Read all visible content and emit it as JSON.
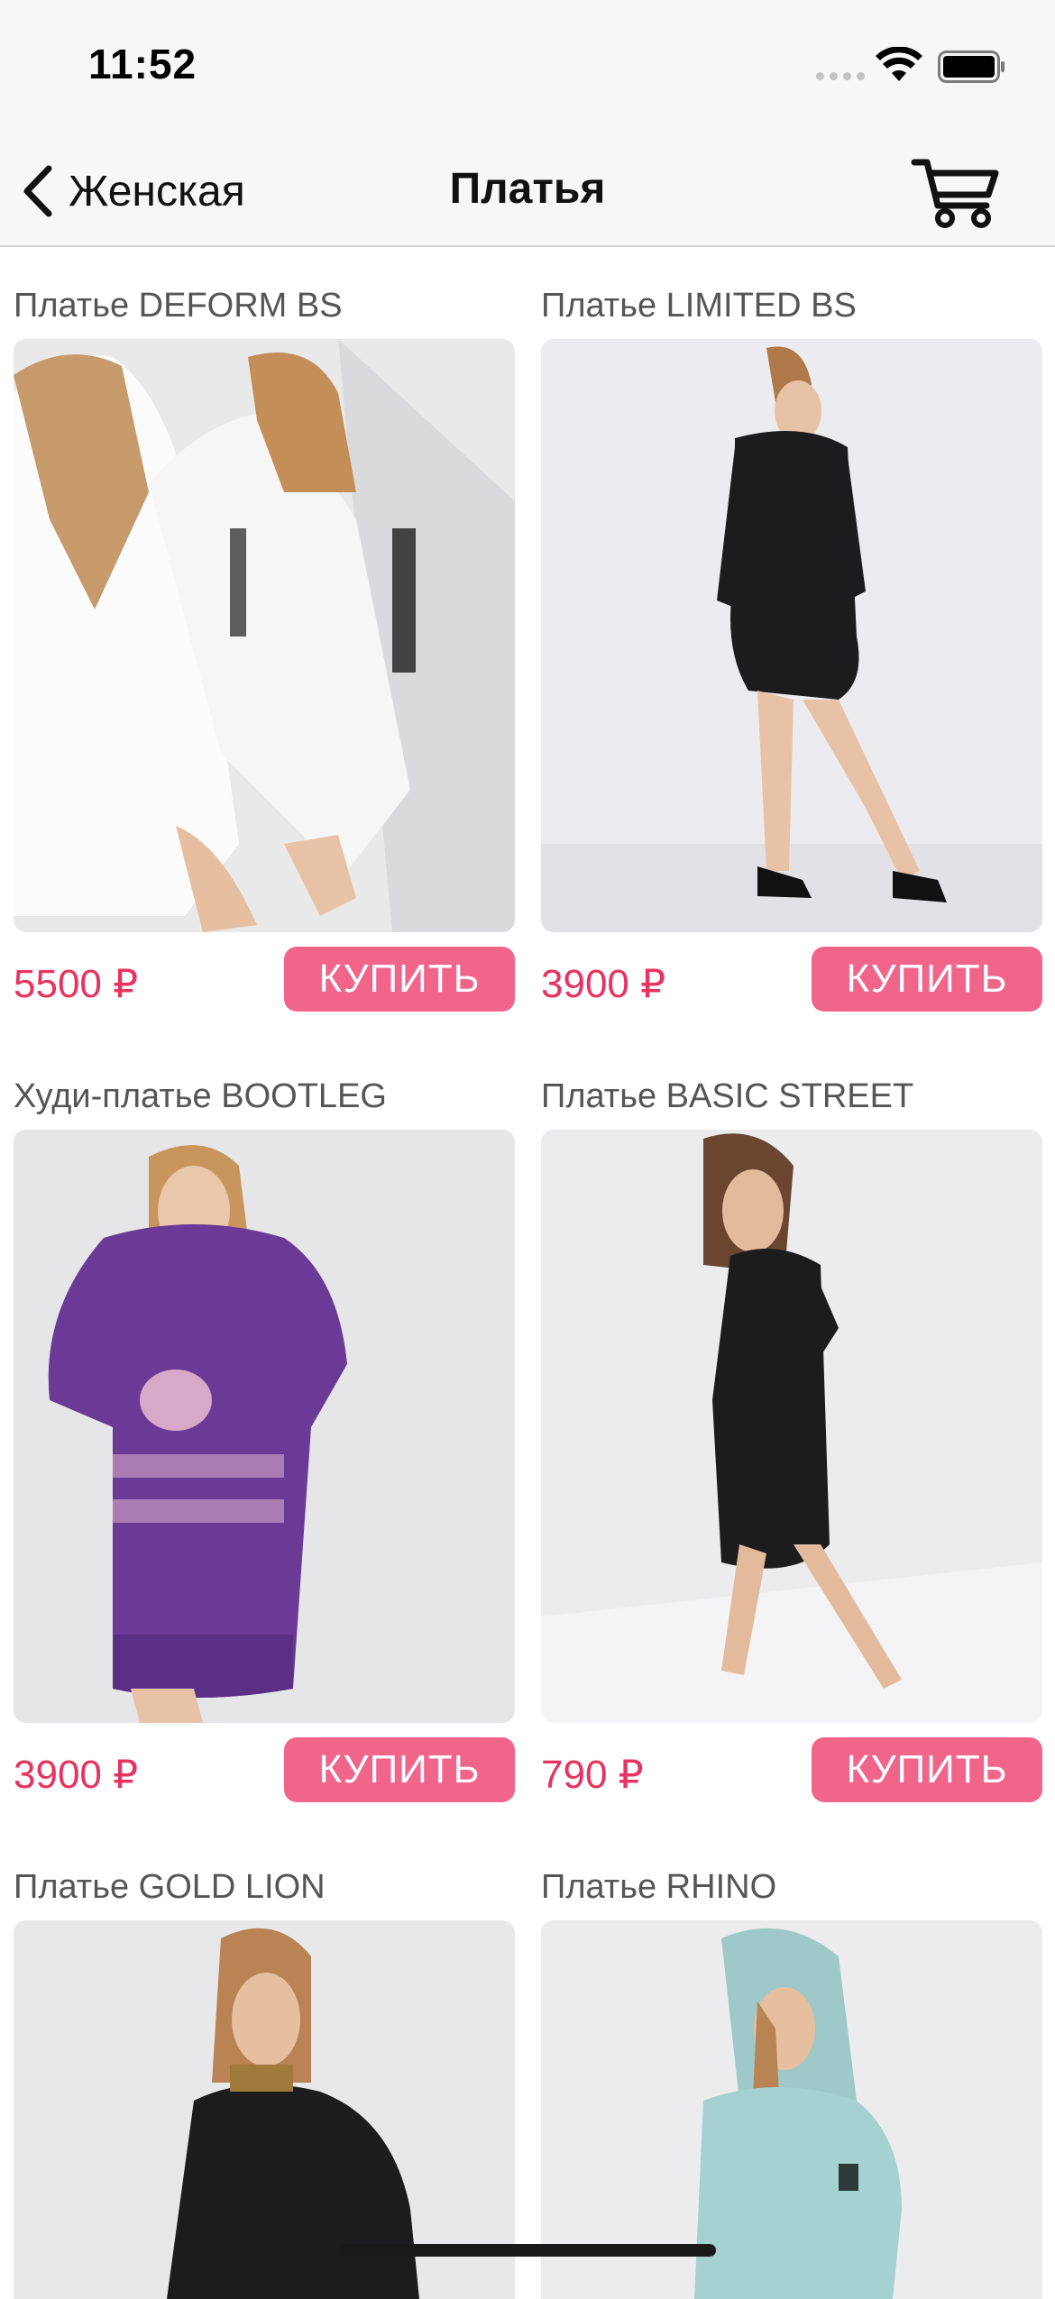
{
  "status_bar": {
    "time": "11:52"
  },
  "nav": {
    "back_label": "Женская",
    "title": "Платья"
  },
  "currency_note": "",
  "products": [
    {
      "title": "Платье DEFORM BS",
      "price": "5500 ₽",
      "buy_label": "КУПИТЬ"
    },
    {
      "title": "Платье LIMITED BS",
      "price": "3900 ₽",
      "buy_label": "КУПИТЬ"
    },
    {
      "title": "Худи-платье BOOTLEG",
      "price": "3900 ₽",
      "buy_label": "КУПИТЬ"
    },
    {
      "title": "Платье BASIC STREET",
      "price": "790 ₽",
      "buy_label": "КУПИТЬ"
    },
    {
      "title": "Платье GOLD LION",
      "price": "",
      "buy_label": ""
    },
    {
      "title": "Платье RHINO",
      "price": "",
      "buy_label": ""
    }
  ],
  "colors": {
    "price": "#e8325f",
    "buy_button": "#f2658a",
    "bar_background": "#f7f7f7"
  },
  "icons": [
    "back-chevron-icon",
    "cart-icon",
    "wifi-icon",
    "battery-icon",
    "signal-icon"
  ]
}
